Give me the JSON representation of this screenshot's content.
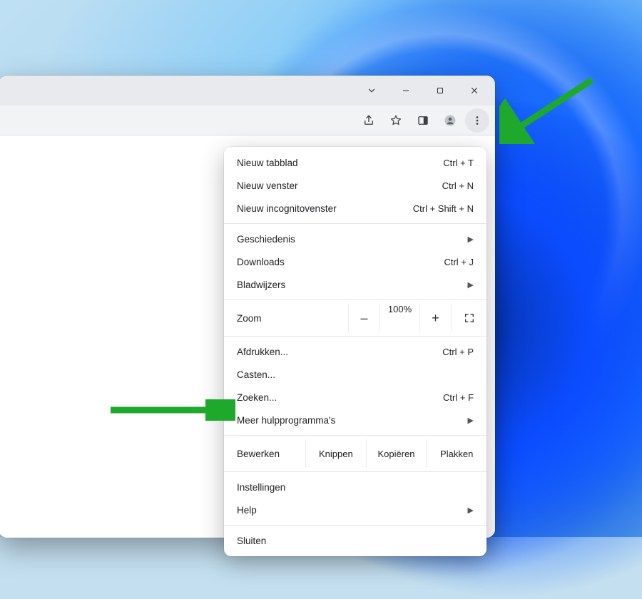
{
  "menu": {
    "new_tab": {
      "label": "Nieuw tabblad",
      "shortcut": "Ctrl + T"
    },
    "new_window": {
      "label": "Nieuw venster",
      "shortcut": "Ctrl + N"
    },
    "new_incognito": {
      "label": "Nieuw incognitovenster",
      "shortcut": "Ctrl + Shift + N"
    },
    "history": {
      "label": "Geschiedenis"
    },
    "downloads": {
      "label": "Downloads",
      "shortcut": "Ctrl + J"
    },
    "bookmarks": {
      "label": "Bladwijzers"
    },
    "zoom": {
      "label": "Zoom",
      "value": "100%",
      "minus": "–",
      "plus": "+"
    },
    "print": {
      "label": "Afdrukken...",
      "shortcut": "Ctrl + P"
    },
    "cast": {
      "label": "Casten..."
    },
    "find": {
      "label": "Zoeken...",
      "shortcut": "Ctrl + F"
    },
    "more_tools": {
      "label": "Meer hulpprogramma's"
    },
    "edit": {
      "label": "Bewerken",
      "cut": "Knippen",
      "copy": "Kopiëren",
      "paste": "Plakken"
    },
    "settings": {
      "label": "Instellingen"
    },
    "help": {
      "label": "Help"
    },
    "exit": {
      "label": "Sluiten"
    }
  },
  "icons": {
    "share": "share-icon",
    "star": "star-icon",
    "sidepanel": "side-panel-icon",
    "profile": "profile-icon",
    "more": "more-vertical-icon",
    "tabsearch": "chevron-down-icon",
    "minimize": "minimize-icon",
    "maximize": "maximize-icon",
    "close": "close-icon"
  },
  "colors": {
    "arrow": "#1ea82c"
  }
}
